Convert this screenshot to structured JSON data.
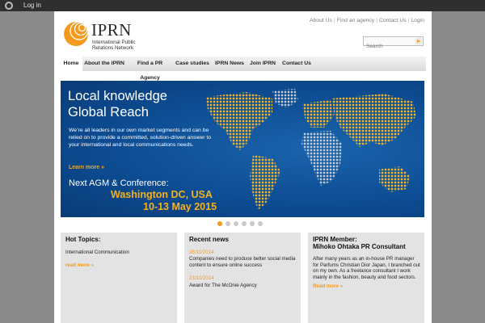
{
  "adminbar": {
    "login_label": "Log in"
  },
  "brand": {
    "name": "IPRN",
    "tagline": "International Public Relations Network",
    "accent": "#f39a1e"
  },
  "toplinks": [
    "About Us",
    "Find an agency",
    "Contact Us",
    "Login"
  ],
  "search": {
    "placeholder": "Search"
  },
  "nav": {
    "items": [
      {
        "label": "Home",
        "active": true
      },
      {
        "label": "About the IPRN"
      },
      {
        "label": "Find a PR Agency"
      },
      {
        "label": "Case studies"
      },
      {
        "label": "IPRN News"
      },
      {
        "label": "Join IPRN"
      },
      {
        "label": "Contact Us"
      }
    ]
  },
  "hero": {
    "headline_1": "Local knowledge",
    "headline_2": "Global Reach",
    "body": "We’re all leaders in our own market segments and can be relied on to provide a committed, solution-driven answer to your international and local communications needs.",
    "learn_more": "Learn more »",
    "agm": "Next AGM & Conference:",
    "city": "Washington DC, USA",
    "dates": "10-13 May 2015",
    "slide_count": 6,
    "active_slide": 1
  },
  "boxes": {
    "hot_topics": {
      "title": "Hot Topics:",
      "text": "International Communication",
      "more": "read more »"
    },
    "recent_news": {
      "title": "Recent news",
      "items": [
        {
          "date": "26/11/2014",
          "text": "Companies need to produce better social media content to ensure online success"
        },
        {
          "date": "21/11/2014",
          "text": "Award for The McOnie Agency"
        }
      ]
    },
    "member": {
      "title_1": "IPRN Member:",
      "title_2": "Mihoko Ohtaka PR Consultant",
      "text": "After many years as an in-house PR manager for Parfums Christian Dior Japan, I branched out on my own. As a freelance consultant I work mainly in the fashion, beauty and food sectors.",
      "more": "Read more »"
    }
  }
}
